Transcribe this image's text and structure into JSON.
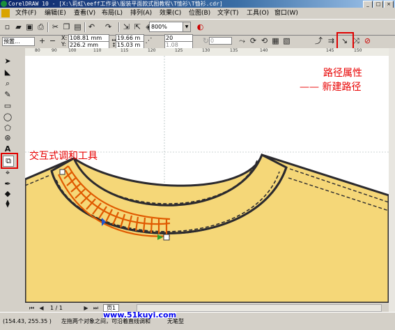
{
  "window": {
    "title": "CorelDRAW 10 - [X:\\莉虹\\eeff工作录\\服装平面款式图教程\\T恤衫\\T恤衫.cdr]",
    "controls": [
      "_",
      "□",
      "×"
    ]
  },
  "menu": [
    "文件(F)",
    "编辑(E)",
    "查看(V)",
    "布局(L)",
    "排列(A)",
    "效果(C)",
    "位图(B)",
    "文字(T)",
    "工具(O)",
    "窗口(W)"
  ],
  "toolbar": {
    "zoom": "800%"
  },
  "propertybar": {
    "preset": "预置...",
    "x_label": "X:",
    "x": "108.81 mm",
    "y_label": "Y:",
    "y": "226.2 mm",
    "w": "19.66 m",
    "h": "15.03 m",
    "steps": "20",
    "offset": "1.08"
  },
  "ruler": {
    "ticks": [
      "80",
      "90",
      "100",
      "110",
      "115",
      "120",
      "125",
      "130",
      "135",
      "140",
      "145",
      "150"
    ]
  },
  "annotations": {
    "path_props": "路径属性",
    "new_path": "—— 新建路径",
    "blend_tool": "交互式调和工具"
  },
  "pages": {
    "position": "1 / 1",
    "tab": "页1"
  },
  "status": {
    "coords": "(154.43, 255.35 )",
    "hint": "左拖两个对象之间，可沿着直线调和",
    "watermark": "www.51kuyi.com",
    "pen": "无笔型"
  },
  "colors": {
    "shirt": "#f5d778",
    "outline": "#2b2a2e",
    "blend": "#e05a00",
    "annotation": "#e80000"
  }
}
